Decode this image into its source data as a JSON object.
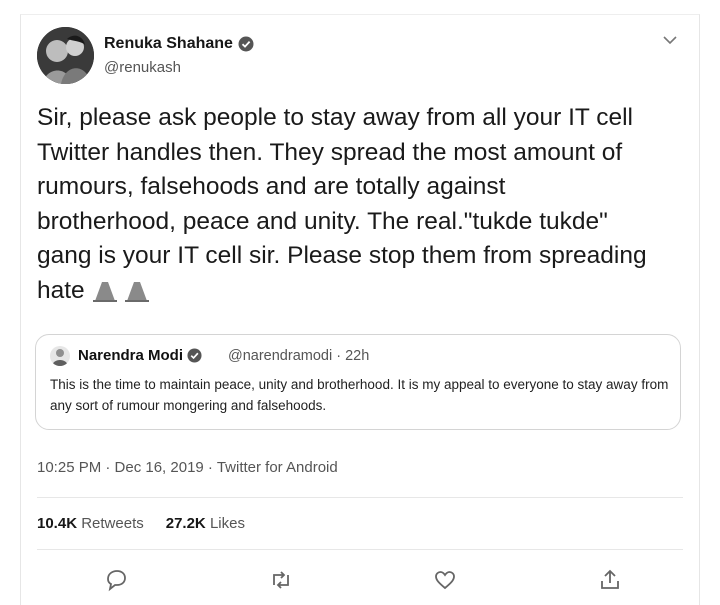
{
  "author": {
    "name": "Renuka Shahane",
    "handle": "@renukash",
    "avatar_icon": "profile-photo-icon",
    "verified_icon": "verified-badge-icon"
  },
  "tweet": {
    "text": "Sir, please ask people to stay away from all your IT cell\nTwitter handles then. They spread the most amount of\nrumours, falsehoods and are totally against\nbrotherhood, peace and unity. The real.\"tukde tukde\"\ngang is your IT cell sir. Please stop them from spreading\nhate",
    "emoji_icon": "folded-hands-icon"
  },
  "quoted_tweet": {
    "name": "Narendra Modi",
    "handle": "@narendramodi · 22h",
    "text": "This is the time to maintain peace, unity and brotherhood. It is my appeal to everyone to stay away from any sort of rumour mongering and falsehoods."
  },
  "meta": {
    "timestamp": "10:25 PM · Dec 16, 2019 · Twitter for Android"
  },
  "stats": {
    "retweets_count": "10.4K",
    "retweets_label": "Retweets",
    "likes_count": "27.2K",
    "likes_label": "Likes"
  },
  "actions": [
    "reply-icon",
    "retweet-icon",
    "like-icon",
    "share-icon"
  ]
}
